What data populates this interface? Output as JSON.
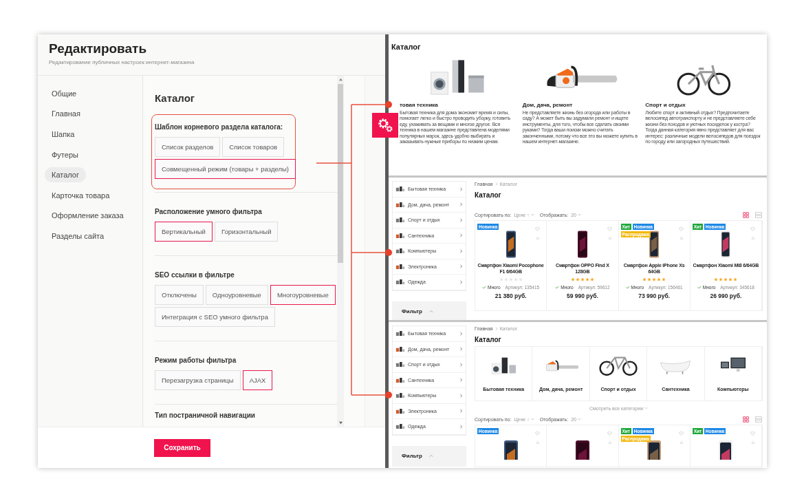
{
  "editor": {
    "title": "Редактировать",
    "subtitle": "Редактирование публичных настроек интернет-магазина",
    "nav": [
      {
        "label": "Общие",
        "selected": false
      },
      {
        "label": "Главная",
        "selected": false
      },
      {
        "label": "Шапка",
        "selected": false
      },
      {
        "label": "Футеры",
        "selected": false
      },
      {
        "label": "Каталог",
        "selected": true
      },
      {
        "label": "Карточка товара",
        "selected": false
      },
      {
        "label": "Оформление заказа",
        "selected": false
      },
      {
        "label": "Разделы сайта",
        "selected": false
      }
    ],
    "section_title": "Каталог",
    "groups": [
      {
        "title": "Шаблон корневого раздела каталога:",
        "highlighted": true,
        "options": [
          {
            "label": "Список разделов",
            "selected": false
          },
          {
            "label": "Список товаров",
            "selected": false
          },
          {
            "label": "Совмещенный режим (товары + разделы)",
            "selected": true
          }
        ]
      },
      {
        "title": "Расположение умного фильтра",
        "highlighted": false,
        "options": [
          {
            "label": "Вертикальный",
            "selected": true
          },
          {
            "label": "Горизонтальный",
            "selected": false
          }
        ]
      },
      {
        "title": "SEO ссылки в фильтре",
        "highlighted": false,
        "options": [
          {
            "label": "Отключены",
            "selected": false
          },
          {
            "label": "Одноуровневые",
            "selected": false
          },
          {
            "label": "Многоуровневые",
            "selected": true
          },
          {
            "label": "Интеграция с SEO умного фильтра",
            "selected": false
          }
        ]
      },
      {
        "title": "Режим работы фильтра",
        "highlighted": false,
        "options": [
          {
            "label": "Перезагрузка страницы",
            "selected": false
          },
          {
            "label": "AJAX",
            "selected": true
          }
        ]
      }
    ],
    "cut_heading": "Тип постраничной навигации",
    "save": "Сохранить"
  },
  "preview": {
    "strip_1": {
      "title": "Каталог",
      "categories": [
        {
          "title": "товая техника",
          "text": "Бытовая техника для дома экономит время и силы, помогает легко и быстро проводить уборку, готовить еду, ухаживать за вещами и многое другое. Вся техника в нашем магазине представлена моделями популярных марок, здесь удобно выбирать и заказывать нужные приборы по низким ценам."
        },
        {
          "title": "Дом, дача, ремонт",
          "text": "Не представляете жизнь без огорода или работы в саду? А может быть вы задумали ремонт и ищете инструменты, для того, чтобы все сделать своими руками? Тогда ваши поиски можно считать законченными, потому что все это вы можете купить в нашем интернет-магазине."
        },
        {
          "title": "Спорт и отдых",
          "text": "Любите спорт и активный отдых? Предпочитаете велосипед автотранспорту и не представляете себе жизни без походов и уютных посиделок у костра? Тогда данная категория явно представляет для вас интерес: различные модели велосипедов для поездок по городу или загородных путешествий."
        }
      ]
    },
    "strip_2": {
      "menu": [
        "Бытовая техника",
        "Дом, дача, ремонт",
        "Спорт и отдых",
        "Сантехника",
        "Компьютеры",
        "Электроника",
        "Одежда"
      ],
      "filter": "Фильтр",
      "breadcrumb": [
        "Главная",
        "Каталог"
      ],
      "title": "Каталог",
      "sort_label": "Сортировать по:",
      "sort_value": "Цене ↑",
      "show_label": "Отображать:",
      "show_value": "20",
      "view": [
        {
          "kind": "grid",
          "selected": true
        },
        {
          "kind": "list",
          "selected": false
        }
      ],
      "products": [
        {
          "badges": [
            {
              "label": "Новинка",
              "color": "#1e88e5"
            }
          ],
          "name": "Смартфон Xiaomi Pocophone F1 6/64GB",
          "stars": 0,
          "stock": "Много",
          "sku": "Артикул: 135415",
          "price": "21 380 руб."
        },
        {
          "name": "Смартфон OPPO Find X 128GB",
          "stars": 5,
          "stock": "Много",
          "sku": "Артикул: 59612",
          "price": "59 990 руб."
        },
        {
          "badges": [
            {
              "label": "Хит",
              "color": "#1fa83c"
            },
            {
              "label": "Новинка",
              "color": "#1e88e5"
            },
            {
              "label": "Распродажа",
              "color": "#f2b90f"
            }
          ],
          "name": "Смартфон Apple iPhone Xs 64GB",
          "stars": 5,
          "stock": "Много",
          "sku": "Артикул: 156461",
          "price": "73 990 руб."
        },
        {
          "badges": [
            {
              "label": "Хит",
              "color": "#1fa83c"
            },
            {
              "label": "Новинка",
              "color": "#1e88e5"
            }
          ],
          "name": "Смартфон Xiaomi Mi8 6/64GB",
          "stars": 5,
          "stock": "Много",
          "sku": "Артикул: 345618",
          "price": "26 990 руб."
        }
      ]
    },
    "strip_3": {
      "menu": [
        "Бытовая техника",
        "Дом, дача, ремонт",
        "Спорт и отдых",
        "Сантехника",
        "Компьютеры",
        "Электроника",
        "Одежда"
      ],
      "filter": "Фильтр",
      "breadcrumb": [
        "Главная",
        "Каталог"
      ],
      "title": "Каталог",
      "categories": [
        "Бытовая техника",
        "Дом, дача, ремонт",
        "Спорт и отдых",
        "Сантехника",
        "Компьютеры"
      ],
      "all_categories": "Смотреть все категории",
      "sort_label": "Сортировать по:",
      "sort_value": "Цене ↑",
      "show_label": "Отображать:",
      "show_value": "20",
      "view": [
        {
          "kind": "grid",
          "selected": true
        },
        {
          "kind": "list",
          "selected": false
        }
      ],
      "products": [
        {
          "kind": "product",
          "badges": [
            {
              "label": "Новинка",
              "color": "#1e88e5"
            }
          ]
        },
        {
          "kind": "product"
        },
        {
          "kind": "product",
          "badges": [
            {
              "label": "Хит",
              "color": "#1fa83c"
            },
            {
              "label": "Новинка",
              "color": "#1e88e5"
            },
            {
              "label": "Распродажа",
              "color": "#f2b90f"
            }
          ]
        },
        {
          "kind": "product",
          "badges": [
            {
              "label": "Хит",
              "color": "#1fa83c"
            },
            {
              "label": "Новинка",
              "color": "#1e88e5"
            }
          ]
        }
      ]
    }
  }
}
